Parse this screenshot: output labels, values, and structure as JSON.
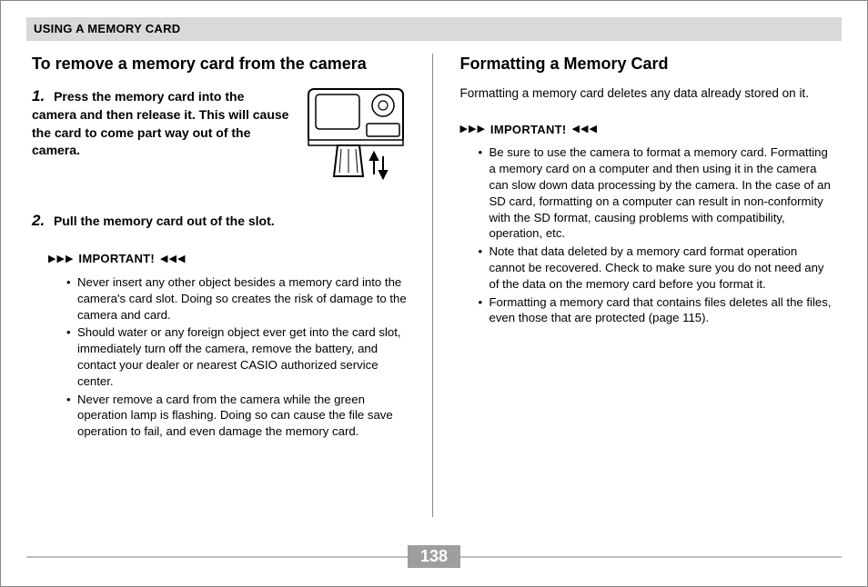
{
  "header": "USING A MEMORY CARD",
  "left": {
    "title": "To remove a memory card from the camera",
    "step1_num": "1.",
    "step1_text": "Press the memory card into the camera and then release it. This will cause the card to come part way out of the camera.",
    "step2_num": "2.",
    "step2_text": "Pull the memory card out of the slot.",
    "important_label": "IMPORTANT!",
    "bullets": [
      "Never insert any other object besides a memory card into the camera's card slot. Doing so creates the risk of damage to the camera and card.",
      "Should water or any foreign object ever get into the card slot, immediately turn off the camera, remove the battery, and contact your dealer or nearest CASIO authorized service center.",
      "Never remove a card from the camera while the green operation lamp is flashing. Doing so can cause the file save operation to fail, and even damage the memory card."
    ]
  },
  "right": {
    "title": "Formatting a Memory Card",
    "intro": "Formatting a memory card deletes any data already stored on it.",
    "important_label": "IMPORTANT!",
    "bullets": [
      "Be sure to use the camera to format a memory card. Formatting a memory card on a computer and then using it in the camera can slow down data processing by the camera. In the case of an SD card, formatting on a computer can result in non-conformity with the SD format, causing problems with compatibility, operation, etc.",
      "Note that data deleted by a memory card format operation cannot be recovered. Check to make sure you do not need any of the data on the memory card before you format it.",
      "Formatting a memory card that contains files deletes all the files, even those that are protected (page 115)."
    ]
  },
  "page_number": "138"
}
